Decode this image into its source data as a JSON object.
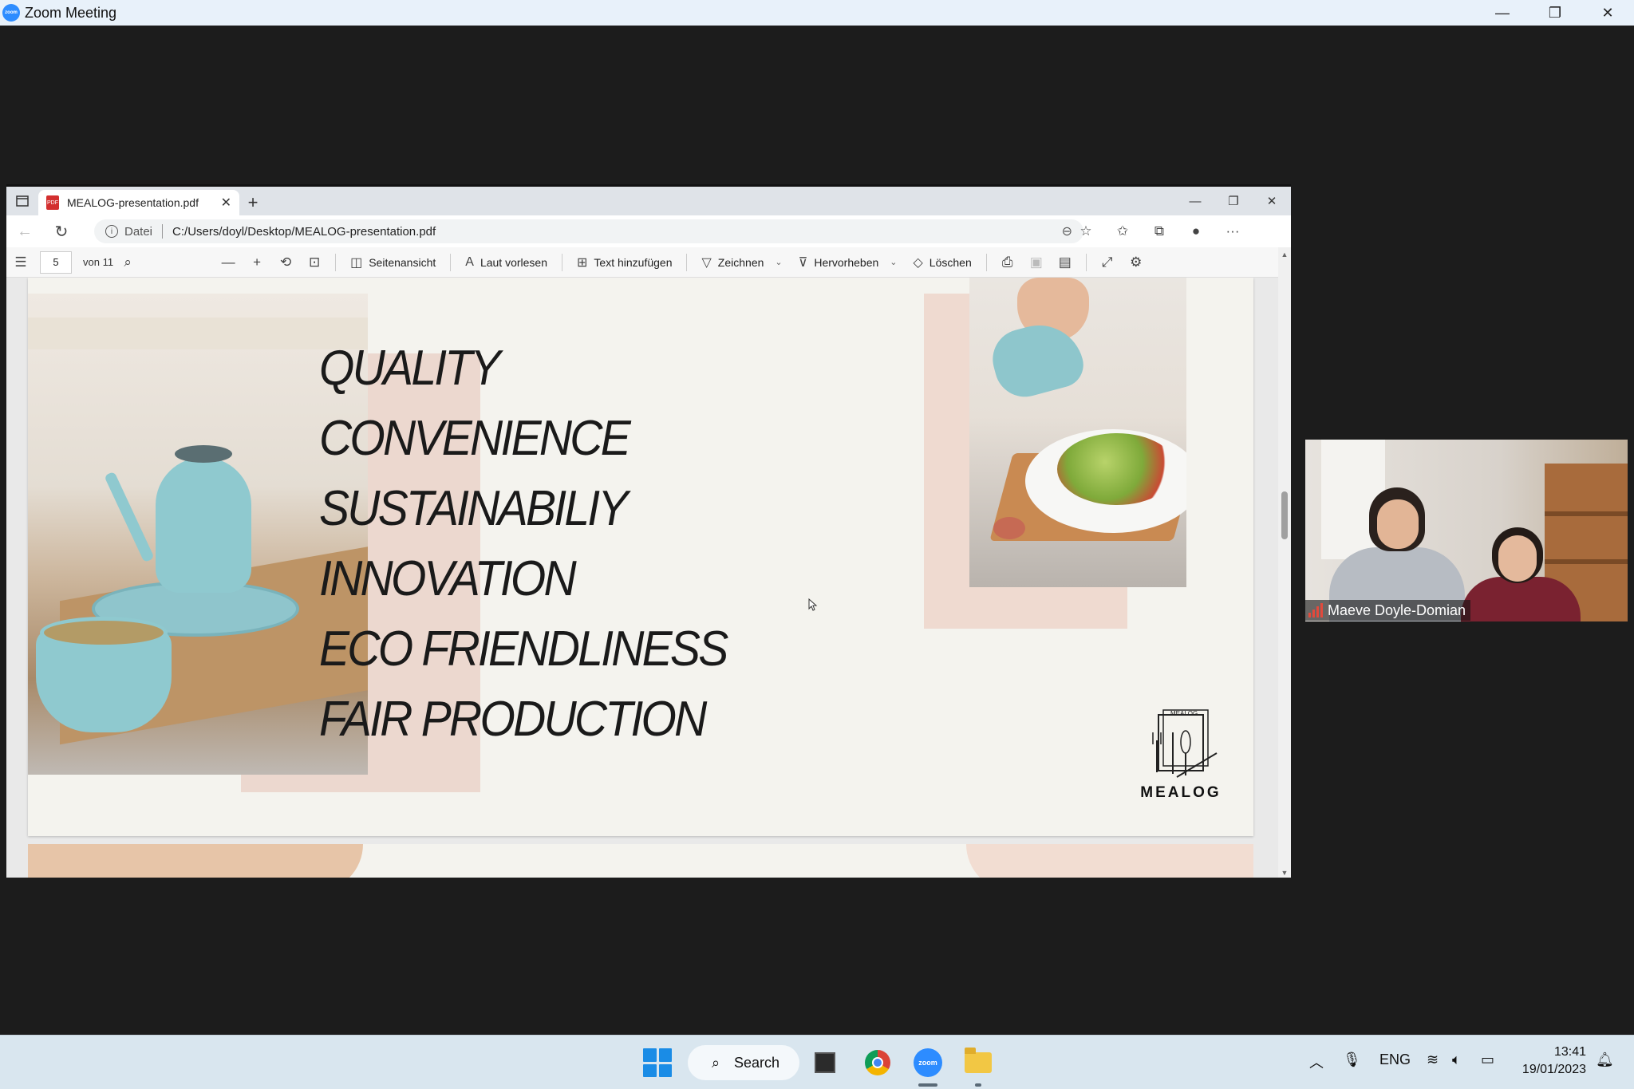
{
  "zoom": {
    "title": "Zoom Meeting",
    "controls": [
      "—",
      "❐",
      "✕"
    ]
  },
  "browser": {
    "tab_title": "MEALOG-presentation.pdf",
    "url_label": "Datei",
    "url": "C:/Users/doyl/Desktop/MEALOG-presentation.pdf"
  },
  "pdf_toolbar": {
    "page_current": "5",
    "page_total": "von 11",
    "page_view": "Seitenansicht",
    "read_aloud": "Laut vorlesen",
    "add_text": "Text hinzufügen",
    "draw": "Zeichnen",
    "highlight": "Hervorheben",
    "erase": "Löschen"
  },
  "slide": {
    "keywords": [
      "QUALITY",
      "CONVENIENCE",
      "SUSTAINABILIY",
      "INNOVATION",
      "ECO FRIENDLINESS",
      "FAIR PRODUCTION"
    ],
    "logo_text": "MEALOG",
    "logo_small": "MEALOG"
  },
  "participant": {
    "name": "Maeve Doyle-Domian"
  },
  "taskbar": {
    "search": "Search",
    "language": "ENG",
    "time": "13:41",
    "date": "19/01/2023"
  },
  "colors": {
    "zoom_blue": "#2d8cff",
    "slide_bg": "#f4f3ee",
    "accent_pink": "#ecd8cf",
    "teal_ceramic": "#8fc9cf"
  }
}
